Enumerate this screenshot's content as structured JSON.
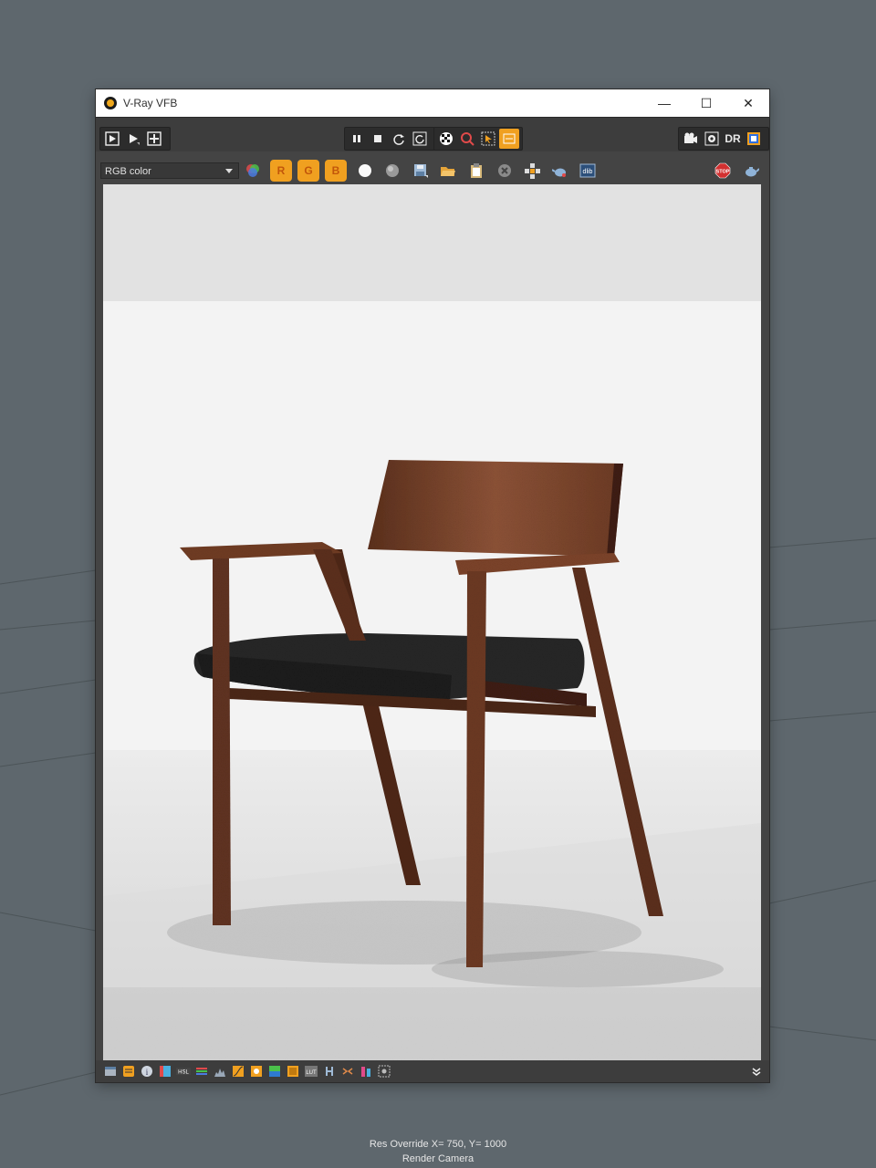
{
  "window": {
    "title": "V-Ray VFB",
    "min_glyph": "—",
    "max_glyph": "☐",
    "close_glyph": "✕"
  },
  "toolbar2": {
    "channel_select": "RGB color",
    "red_label": "R",
    "green_label": "G",
    "blue_label": "B",
    "dr_label": "DR"
  },
  "status": {
    "line1": "Res Override  X= 750, Y= 1000",
    "line2": "Render Camera"
  },
  "colors": {
    "accent": "#f0a020",
    "viewport_bg": "#5e676d",
    "wood": "#6b3b24",
    "seat": "#262626"
  },
  "icons": {
    "toolbar1": [
      "render-icon",
      "render-interactive-icon",
      "region-render-icon",
      "pause-icon",
      "stop-icon",
      "refresh-icon",
      "update-icon",
      "checker-icon",
      "lens-icon",
      "pick-icon",
      "fit-icon",
      "render-settings-icon",
      "gear-icon",
      "distributed-render-icon",
      "color-swatch-icon"
    ],
    "toolbar2": [
      "color-corrections-icon",
      "white-point-icon",
      "gray-point-icon",
      "save-icon",
      "open-icon",
      "clipboard-icon",
      "clear-icon",
      "multi-chan-icon",
      "teapot-icon",
      "dlib-icon",
      "stop-render-icon",
      "teapot-alt-icon"
    ],
    "bottom": [
      "window-icon",
      "history-icon",
      "info-icon",
      "lens-fx-icon",
      "hsl-icon",
      "levels-icon",
      "histogram-icon",
      "curves-icon",
      "exposure-icon",
      "white-balance-icon",
      "bg-icon",
      "lut-icon",
      "h-icon",
      "split-icon",
      "compare-icon",
      "stamp-icon",
      "expand-icon"
    ]
  }
}
